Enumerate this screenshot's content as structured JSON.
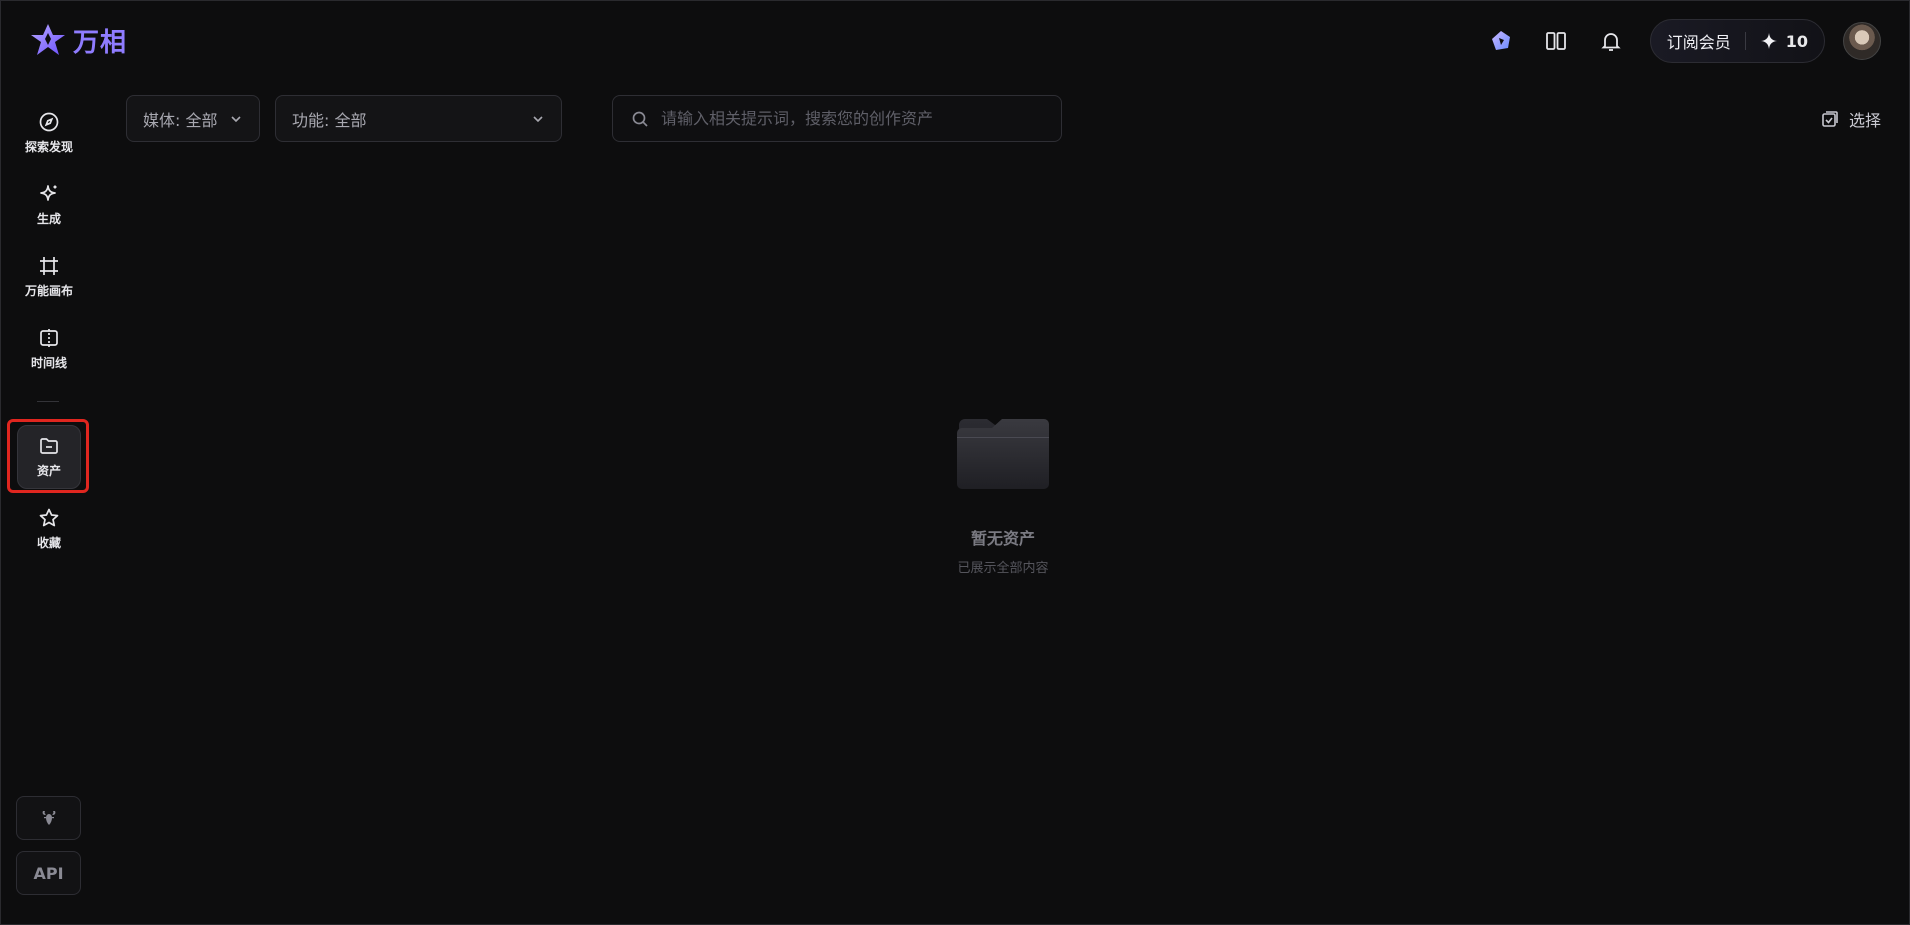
{
  "app": {
    "name": "万相",
    "brand_color": "#8f7cff"
  },
  "header": {
    "subscribe_label": "订阅会员",
    "credits": "10",
    "icons": [
      "app-switch-icon",
      "book-icon",
      "bell-icon",
      "credits-sparkle-icon"
    ]
  },
  "sidebar": {
    "items": [
      {
        "label": "探索发现",
        "icon": "compass-icon"
      },
      {
        "label": "生成",
        "icon": "sparkle-icon"
      },
      {
        "label": "万能画布",
        "icon": "canvas-icon"
      },
      {
        "label": "时间线",
        "icon": "timeline-icon"
      },
      {
        "label": "资产",
        "icon": "folder-icon",
        "active": true
      },
      {
        "label": "收藏",
        "icon": "star-icon"
      }
    ],
    "bottom": {
      "mascot_icon": "lobster-icon",
      "api_label": "API"
    }
  },
  "filters": {
    "media": "媒体: 全部",
    "function": "功能: 全部",
    "search_placeholder": "请输入相关提示词，搜索您的创作资产",
    "select_label": "选择"
  },
  "empty_state": {
    "title": "暂无资产",
    "subtitle": "已展示全部内容"
  },
  "colors": {
    "background": "#0d0d0e",
    "highlight": "#e0261f"
  }
}
